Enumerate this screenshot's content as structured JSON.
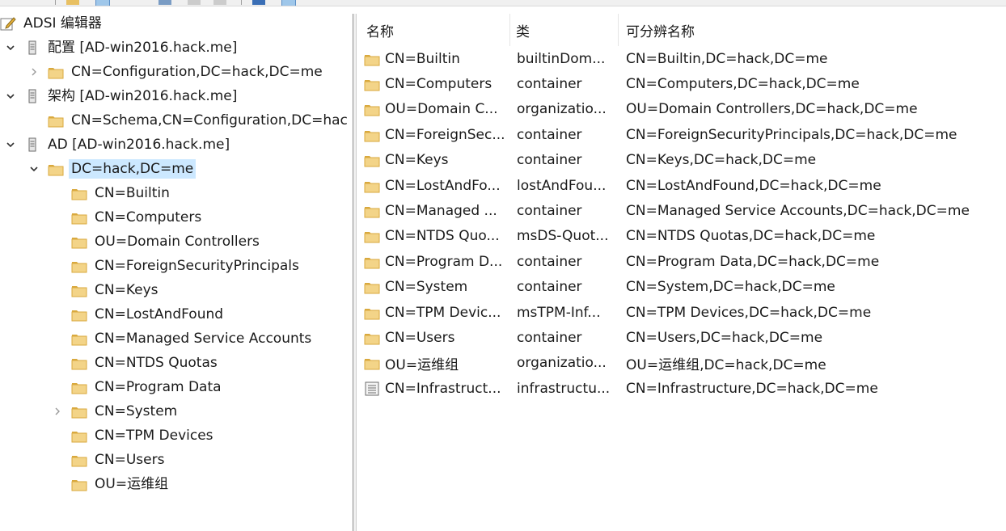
{
  "tree": {
    "root": {
      "label": "ADSI 编辑器",
      "icon": "adsi-edit-icon"
    },
    "nodes": [
      {
        "label": "配置 [AD-win2016.hack.me]",
        "icon": "server-icon",
        "expander": "expanded"
      },
      {
        "label": "CN=Configuration,DC=hack,DC=me",
        "icon": "folder-icon",
        "expander": "collapsed"
      },
      {
        "label": "架构 [AD-win2016.hack.me]",
        "icon": "server-icon",
        "expander": "expanded"
      },
      {
        "label": "CN=Schema,CN=Configuration,DC=hac",
        "icon": "folder-icon",
        "expander": "none"
      },
      {
        "label": "AD  [AD-win2016.hack.me]",
        "icon": "server-icon",
        "expander": "expanded"
      },
      {
        "label": "DC=hack,DC=me",
        "icon": "folder-icon",
        "expander": "expanded",
        "selected": true
      },
      {
        "label": "CN=Builtin",
        "icon": "folder-icon",
        "expander": "none"
      },
      {
        "label": "CN=Computers",
        "icon": "folder-icon",
        "expander": "none"
      },
      {
        "label": "OU=Domain Controllers",
        "icon": "folder-icon",
        "expander": "none"
      },
      {
        "label": "CN=ForeignSecurityPrincipals",
        "icon": "folder-icon",
        "expander": "none"
      },
      {
        "label": "CN=Keys",
        "icon": "folder-icon",
        "expander": "none"
      },
      {
        "label": "CN=LostAndFound",
        "icon": "folder-icon",
        "expander": "none"
      },
      {
        "label": "CN=Managed Service Accounts",
        "icon": "folder-icon",
        "expander": "none"
      },
      {
        "label": "CN=NTDS Quotas",
        "icon": "folder-icon",
        "expander": "none"
      },
      {
        "label": "CN=Program Data",
        "icon": "folder-icon",
        "expander": "none"
      },
      {
        "label": "CN=System",
        "icon": "folder-icon",
        "expander": "collapsed"
      },
      {
        "label": "CN=TPM Devices",
        "icon": "folder-icon",
        "expander": "none"
      },
      {
        "label": "CN=Users",
        "icon": "folder-icon",
        "expander": "none"
      },
      {
        "label": "OU=运维组",
        "icon": "folder-icon",
        "expander": "none"
      }
    ]
  },
  "list": {
    "columns": [
      "名称",
      "类",
      "可分辨名称"
    ],
    "rows": [
      {
        "name": "CN=Builtin",
        "class": "builtinDom...",
        "dn": "CN=Builtin,DC=hack,DC=me",
        "icon": "folder-icon"
      },
      {
        "name": "CN=Computers",
        "class": "container",
        "dn": "CN=Computers,DC=hack,DC=me",
        "icon": "folder-icon"
      },
      {
        "name": "OU=Domain C...",
        "class": "organizatio...",
        "dn": "OU=Domain Controllers,DC=hack,DC=me",
        "icon": "folder-icon"
      },
      {
        "name": "CN=ForeignSec...",
        "class": "container",
        "dn": "CN=ForeignSecurityPrincipals,DC=hack,DC=me",
        "icon": "folder-icon"
      },
      {
        "name": "CN=Keys",
        "class": "container",
        "dn": "CN=Keys,DC=hack,DC=me",
        "icon": "folder-icon"
      },
      {
        "name": "CN=LostAndFo...",
        "class": "lostAndFou...",
        "dn": "CN=LostAndFound,DC=hack,DC=me",
        "icon": "folder-icon"
      },
      {
        "name": "CN=Managed ...",
        "class": "container",
        "dn": "CN=Managed Service Accounts,DC=hack,DC=me",
        "icon": "folder-icon"
      },
      {
        "name": "CN=NTDS Quo...",
        "class": "msDS-Quot...",
        "dn": "CN=NTDS Quotas,DC=hack,DC=me",
        "icon": "folder-icon"
      },
      {
        "name": "CN=Program D...",
        "class": "container",
        "dn": "CN=Program Data,DC=hack,DC=me",
        "icon": "folder-icon"
      },
      {
        "name": "CN=System",
        "class": "container",
        "dn": "CN=System,DC=hack,DC=me",
        "icon": "folder-icon"
      },
      {
        "name": "CN=TPM Devic...",
        "class": "msTPM-Inf...",
        "dn": "CN=TPM Devices,DC=hack,DC=me",
        "icon": "folder-icon"
      },
      {
        "name": "CN=Users",
        "class": "container",
        "dn": "CN=Users,DC=hack,DC=me",
        "icon": "folder-icon"
      },
      {
        "name": "OU=运维组",
        "class": "organizatio...",
        "dn": "OU=运维组,DC=hack,DC=me",
        "icon": "folder-icon"
      },
      {
        "name": "CN=Infrastruct...",
        "class": "infrastructu...",
        "dn": "CN=Infrastructure,DC=hack,DC=me",
        "icon": "document-icon"
      }
    ]
  },
  "colors": {
    "selection": "#cce8ff",
    "folder": "#f3d488",
    "folder_dark": "#d9a93e"
  }
}
